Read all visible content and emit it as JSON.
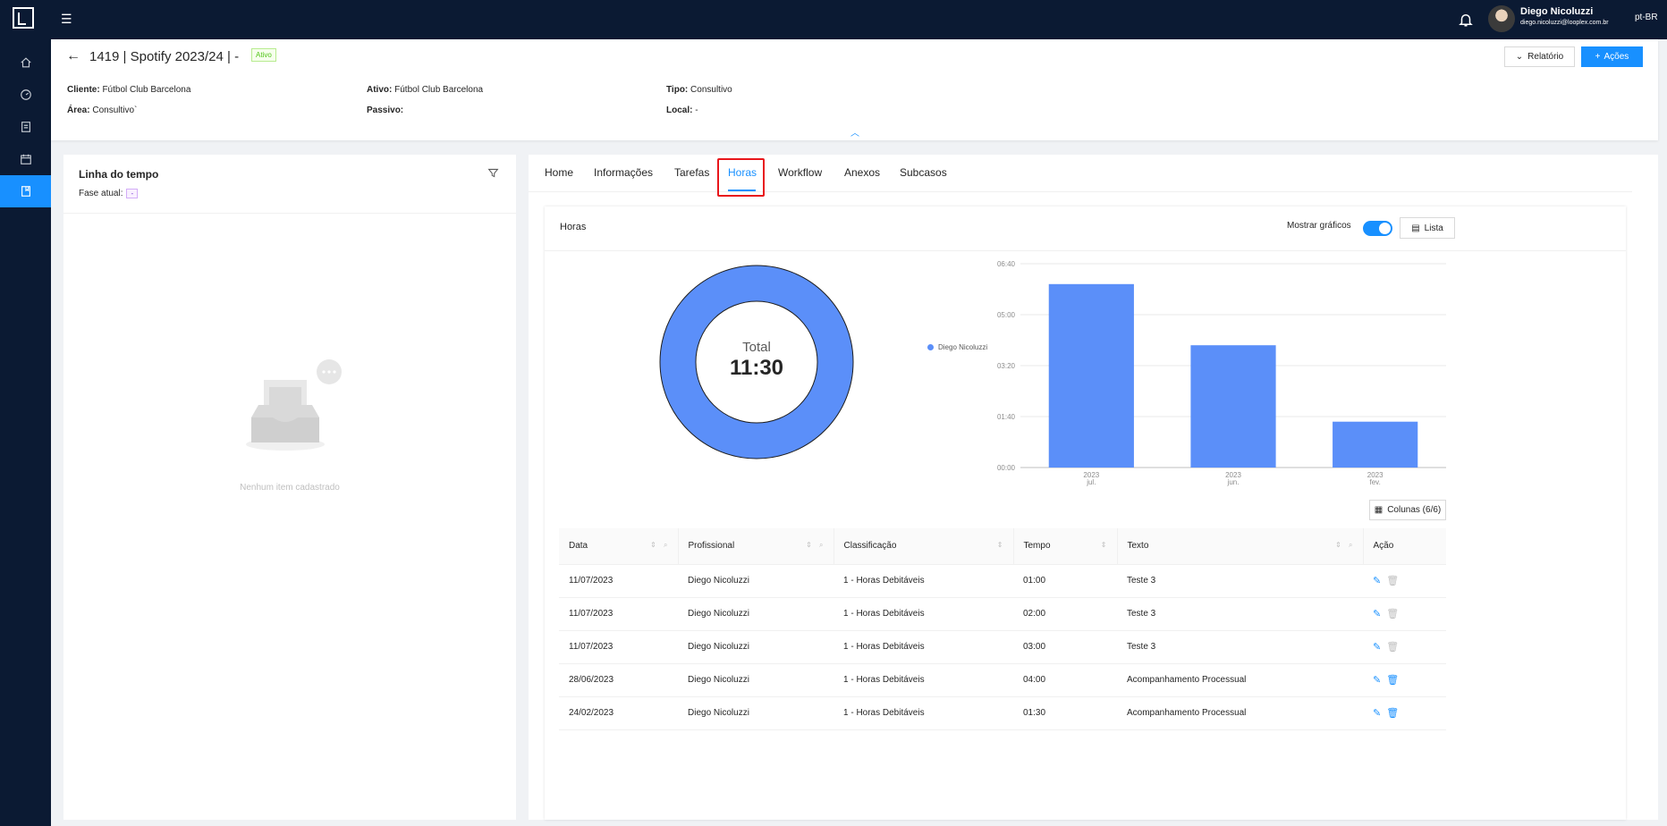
{
  "topbar": {
    "user_name": "Diego Nicoluzzi",
    "user_email": "diego.nicoluzzi@looplex.com.br",
    "language": "pt-BR"
  },
  "sidebar": {
    "items": [
      {
        "icon": "home-icon"
      },
      {
        "icon": "dashboard-icon"
      },
      {
        "icon": "documents-icon"
      },
      {
        "icon": "calendar-icon"
      },
      {
        "icon": "cases-icon",
        "active": true
      }
    ]
  },
  "header": {
    "title": "1419 | Spotify 2023/24 | -",
    "status_tag": "Ativo",
    "relatorio_label": "Relatório",
    "acoes_label": "Ações",
    "fields": {
      "cliente_label": "Cliente:",
      "cliente_value": "Fútbol Club Barcelona",
      "ativo_label": "Ativo:",
      "ativo_value": "Fútbol Club Barcelona",
      "tipo_label": "Tipo:",
      "tipo_value": "Consultivo",
      "area_label": "Área:",
      "area_value": "Consultivo`",
      "passivo_label": "Passivo:",
      "passivo_value": "",
      "local_label": "Local:",
      "local_value": "-"
    }
  },
  "timeline": {
    "title": "Linha do tempo",
    "fase_label": "Fase atual:",
    "fase_value": "-",
    "empty_text": "Nenhum item cadastrado"
  },
  "tabs": [
    {
      "label": "Home"
    },
    {
      "label": "Informações"
    },
    {
      "label": "Tarefas"
    },
    {
      "label": "Horas",
      "active": true
    },
    {
      "label": "Workflow"
    },
    {
      "label": "Anexos"
    },
    {
      "label": "Subcasos"
    }
  ],
  "horas": {
    "title": "Horas",
    "mostrar_graficos_label": "Mostrar gráficos",
    "mostrar_graficos_on": true,
    "lista_label": "Lista",
    "total_label": "Total",
    "total_value": "11:30",
    "legend_name": "Diego Nicoluzzi",
    "colunas_label": "Colunas (6/6)",
    "columns": [
      "Data",
      "Profissional",
      "Classificação",
      "Tempo",
      "Texto",
      "Ação"
    ],
    "rows": [
      {
        "data": "11/07/2023",
        "profissional": "Diego Nicoluzzi",
        "classificacao": "1 - Horas Debitáveis",
        "tempo": "01:00",
        "texto": "Teste 3",
        "delete_enabled": false
      },
      {
        "data": "11/07/2023",
        "profissional": "Diego Nicoluzzi",
        "classificacao": "1 - Horas Debitáveis",
        "tempo": "02:00",
        "texto": "Teste 3",
        "delete_enabled": false
      },
      {
        "data": "11/07/2023",
        "profissional": "Diego Nicoluzzi",
        "classificacao": "1 - Horas Debitáveis",
        "tempo": "03:00",
        "texto": "Teste 3",
        "delete_enabled": false
      },
      {
        "data": "28/06/2023",
        "profissional": "Diego Nicoluzzi",
        "classificacao": "1 - Horas Debitáveis",
        "tempo": "04:00",
        "texto": "Acompanhamento Processual",
        "delete_enabled": true
      },
      {
        "data": "24/02/2023",
        "profissional": "Diego Nicoluzzi",
        "classificacao": "1 - Horas Debitáveis",
        "tempo": "01:30",
        "texto": "Acompanhamento Processual",
        "delete_enabled": true
      }
    ]
  },
  "chart_data": [
    {
      "type": "pie",
      "labels": [
        "Diego Nicoluzzi"
      ],
      "values": [
        11.5
      ],
      "center_label": "Total",
      "center_value": "11:30",
      "colors": [
        "#5b8ff9"
      ]
    },
    {
      "type": "bar",
      "categories": [
        [
          "2023",
          "jul."
        ],
        [
          "2023",
          "jun."
        ],
        [
          "2023",
          "fev."
        ]
      ],
      "values": [
        6.0,
        4.0,
        1.5
      ],
      "ylim": [
        0,
        6.6667
      ],
      "yticks": [
        0,
        1.6667,
        3.3333,
        5.0,
        6.6667
      ],
      "ytick_labels": [
        "00:00",
        "01:40",
        "03:20",
        "05:00",
        "06:40"
      ],
      "grid": true,
      "color": "#5b8ff9"
    }
  ],
  "colors": {
    "primary": "#1890ff",
    "navbar": "#0b1a33",
    "chart": "#5b8ff9",
    "highlight": "#e8161b"
  }
}
